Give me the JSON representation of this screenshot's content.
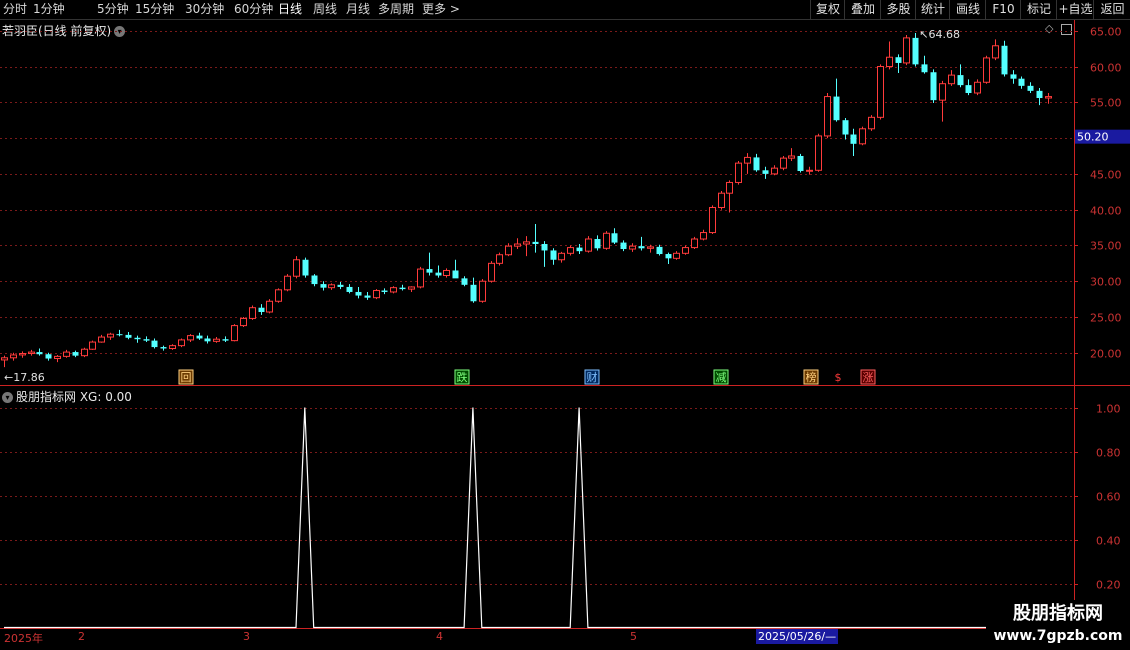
{
  "toolbar": {
    "periods": [
      "分时",
      "1分钟",
      "5分钟",
      "15分钟",
      "30分钟",
      "60分钟",
      "日线",
      "周线",
      "月线",
      "多周期",
      "更多 >"
    ],
    "active_period": "日线",
    "right_buttons": [
      "复权",
      "叠加",
      "多股",
      "统计",
      "画线",
      "F10",
      "标记",
      "+自选",
      "返回"
    ]
  },
  "main": {
    "title": "若羽臣(日线 前复权)",
    "price_axis": [
      "65.00",
      "60.00",
      "55.00",
      "50.00",
      "45.00",
      "40.00",
      "35.00",
      "30.00",
      "25.00",
      "20.00"
    ],
    "current_price": "50.20",
    "high_marker": "64.68",
    "low_marker": "17.86",
    "event_markers": [
      "回",
      "跌",
      "财",
      "减",
      "榜",
      "$",
      "涨"
    ]
  },
  "indicator": {
    "title": "股朋指标网 XG: 0.00",
    "axis": [
      "1.00",
      "0.80",
      "0.60",
      "0.40",
      "0.20"
    ]
  },
  "date_axis": {
    "ticks": [
      "2025年",
      "2",
      "3",
      "4",
      "5"
    ],
    "current_date": "2025/05/26/—"
  },
  "watermark": {
    "line1": "股朋指标网",
    "line2": "www.7gpzb.com"
  },
  "colors": {
    "up": "#ff3b3b",
    "down": "#54ffff",
    "axis_red": "#cc2222",
    "current_price_bg": "#1a1aa0"
  },
  "chart_data": {
    "type": "candlestick",
    "price_ylim": [
      15.5,
      66.5
    ],
    "candles_ohlc": [
      [
        19.0,
        19.6,
        18.0,
        19.3
      ],
      [
        19.3,
        20.0,
        18.9,
        19.7
      ],
      [
        19.7,
        20.2,
        19.3,
        19.9
      ],
      [
        19.9,
        20.4,
        19.6,
        20.1
      ],
      [
        20.1,
        20.6,
        19.6,
        19.8
      ],
      [
        19.8,
        20.0,
        18.9,
        19.2
      ],
      [
        19.2,
        19.7,
        18.7,
        19.5
      ],
      [
        19.5,
        20.4,
        19.3,
        20.1
      ],
      [
        20.1,
        20.3,
        19.4,
        19.6
      ],
      [
        19.6,
        20.7,
        19.4,
        20.5
      ],
      [
        20.5,
        21.7,
        20.4,
        21.5
      ],
      [
        21.5,
        22.5,
        21.4,
        22.2
      ],
      [
        22.2,
        22.8,
        21.8,
        22.6
      ],
      [
        22.6,
        23.2,
        22.3,
        22.5
      ],
      [
        22.5,
        22.9,
        21.9,
        22.1
      ],
      [
        22.1,
        22.4,
        21.4,
        21.9
      ],
      [
        21.9,
        22.3,
        21.5,
        21.7
      ],
      [
        21.7,
        22.0,
        20.6,
        20.8
      ],
      [
        20.8,
        21.0,
        20.3,
        20.6
      ],
      [
        20.6,
        21.2,
        20.4,
        21.0
      ],
      [
        21.0,
        22.0,
        20.8,
        21.8
      ],
      [
        21.8,
        22.6,
        21.5,
        22.4
      ],
      [
        22.4,
        22.8,
        21.8,
        22.0
      ],
      [
        22.0,
        22.4,
        21.3,
        21.6
      ],
      [
        21.6,
        22.2,
        21.4,
        21.9
      ],
      [
        21.9,
        22.3,
        21.5,
        21.7
      ],
      [
        21.7,
        24.0,
        21.6,
        23.8
      ],
      [
        23.8,
        25.0,
        23.6,
        24.8
      ],
      [
        24.8,
        26.6,
        24.6,
        26.3
      ],
      [
        26.3,
        26.8,
        25.3,
        25.7
      ],
      [
        25.7,
        27.5,
        25.5,
        27.2
      ],
      [
        27.2,
        29.0,
        27.0,
        28.8
      ],
      [
        28.8,
        31.0,
        28.6,
        30.7
      ],
      [
        30.7,
        33.5,
        30.4,
        33.0
      ],
      [
        33.0,
        33.3,
        30.5,
        30.8
      ],
      [
        30.8,
        31.0,
        29.3,
        29.6
      ],
      [
        29.6,
        30.0,
        28.7,
        29.1
      ],
      [
        29.1,
        29.7,
        28.8,
        29.5
      ],
      [
        29.5,
        29.9,
        28.9,
        29.2
      ],
      [
        29.2,
        29.6,
        28.3,
        28.5
      ],
      [
        28.5,
        29.2,
        27.6,
        28.0
      ],
      [
        28.0,
        28.5,
        27.4,
        27.7
      ],
      [
        27.7,
        28.9,
        27.5,
        28.7
      ],
      [
        28.7,
        29.0,
        28.2,
        28.5
      ],
      [
        28.5,
        29.3,
        28.3,
        29.1
      ],
      [
        29.1,
        29.5,
        28.7,
        28.9
      ],
      [
        28.9,
        29.3,
        28.5,
        29.2
      ],
      [
        29.2,
        32.0,
        29.0,
        31.7
      ],
      [
        31.7,
        34.0,
        30.8,
        31.2
      ],
      [
        31.2,
        32.2,
        30.5,
        30.8
      ],
      [
        30.8,
        31.8,
        30.5,
        31.5
      ],
      [
        31.5,
        33.0,
        31.3,
        30.4
      ],
      [
        30.4,
        30.7,
        29.3,
        29.5
      ],
      [
        29.5,
        30.5,
        27.0,
        27.2
      ],
      [
        27.2,
        30.3,
        27.0,
        30.0
      ],
      [
        30.0,
        32.8,
        29.8,
        32.5
      ],
      [
        32.5,
        34.0,
        32.2,
        33.7
      ],
      [
        33.7,
        35.3,
        33.5,
        34.9
      ],
      [
        34.9,
        36.0,
        34.5,
        35.2
      ],
      [
        35.2,
        36.3,
        33.5,
        35.5
      ],
      [
        35.5,
        38.0,
        34.0,
        35.2
      ],
      [
        35.2,
        35.6,
        32.0,
        34.3
      ],
      [
        34.3,
        34.6,
        32.3,
        33.0
      ],
      [
        33.0,
        34.1,
        32.6,
        33.9
      ],
      [
        33.9,
        35.0,
        33.6,
        34.7
      ],
      [
        34.7,
        35.2,
        33.8,
        34.2
      ],
      [
        34.2,
        36.3,
        34.0,
        35.9
      ],
      [
        35.9,
        36.4,
        34.3,
        34.6
      ],
      [
        34.6,
        37.0,
        34.4,
        36.7
      ],
      [
        36.7,
        37.4,
        35.2,
        35.4
      ],
      [
        35.4,
        35.7,
        34.2,
        34.5
      ],
      [
        34.5,
        35.3,
        34.1,
        34.9
      ],
      [
        34.9,
        36.2,
        34.3,
        34.6
      ],
      [
        34.6,
        35.1,
        34.0,
        34.8
      ],
      [
        34.8,
        35.1,
        33.6,
        33.8
      ],
      [
        33.8,
        34.0,
        32.4,
        33.2
      ],
      [
        33.2,
        34.2,
        33.0,
        33.9
      ],
      [
        33.9,
        35.0,
        33.7,
        34.7
      ],
      [
        34.7,
        36.2,
        34.5,
        35.9
      ],
      [
        35.9,
        37.2,
        35.7,
        36.8
      ],
      [
        36.8,
        40.6,
        36.6,
        40.3
      ],
      [
        40.3,
        42.6,
        40.0,
        42.3
      ],
      [
        42.3,
        44.1,
        39.6,
        43.8
      ],
      [
        43.8,
        46.8,
        43.5,
        46.5
      ],
      [
        46.5,
        47.9,
        45.0,
        47.3
      ],
      [
        47.3,
        47.8,
        45.3,
        45.5
      ],
      [
        45.5,
        46.0,
        44.3,
        45.0
      ],
      [
        45.0,
        46.2,
        44.8,
        45.8
      ],
      [
        45.8,
        47.5,
        45.5,
        47.2
      ],
      [
        47.2,
        48.6,
        46.8,
        47.5
      ],
      [
        47.5,
        47.8,
        45.2,
        45.4
      ],
      [
        45.4,
        46.0,
        44.9,
        45.5
      ],
      [
        45.5,
        50.6,
        45.3,
        50.3
      ],
      [
        50.3,
        56.3,
        50.0,
        55.8
      ],
      [
        55.8,
        58.3,
        52.3,
        52.5
      ],
      [
        52.5,
        52.8,
        49.8,
        50.5
      ],
      [
        50.5,
        51.3,
        47.5,
        49.2
      ],
      [
        49.2,
        51.6,
        49.0,
        51.3
      ],
      [
        51.3,
        53.2,
        51.0,
        52.9
      ],
      [
        52.9,
        60.3,
        52.6,
        60.0
      ],
      [
        60.0,
        63.5,
        59.6,
        61.3
      ],
      [
        61.3,
        61.7,
        59.1,
        60.5
      ],
      [
        60.5,
        64.4,
        60.2,
        64.0
      ],
      [
        64.0,
        64.68,
        60.0,
        60.3
      ],
      [
        60.3,
        61.5,
        59.0,
        59.2
      ],
      [
        59.2,
        59.6,
        54.9,
        55.3
      ],
      [
        55.3,
        58.0,
        52.3,
        57.6
      ],
      [
        57.6,
        59.5,
        57.3,
        58.8
      ],
      [
        58.8,
        60.3,
        57.1,
        57.4
      ],
      [
        57.4,
        58.2,
        56.0,
        56.3
      ],
      [
        56.3,
        58.2,
        56.0,
        57.8
      ],
      [
        57.8,
        61.5,
        57.6,
        61.2
      ],
      [
        61.2,
        63.8,
        60.9,
        62.9
      ],
      [
        62.9,
        63.6,
        58.6,
        58.9
      ],
      [
        58.9,
        59.5,
        57.6,
        58.3
      ],
      [
        58.3,
        58.6,
        56.9,
        57.3
      ],
      [
        57.3,
        57.8,
        56.3,
        56.6
      ],
      [
        56.6,
        57.0,
        54.6,
        55.6
      ],
      [
        55.6,
        56.3,
        54.8,
        55.8
      ]
    ],
    "indicator": {
      "name": "XG",
      "ylim": [
        0,
        1.1
      ],
      "values_nonzero_indices": [
        34,
        53,
        65
      ],
      "value_at_signal": 1.0
    }
  }
}
